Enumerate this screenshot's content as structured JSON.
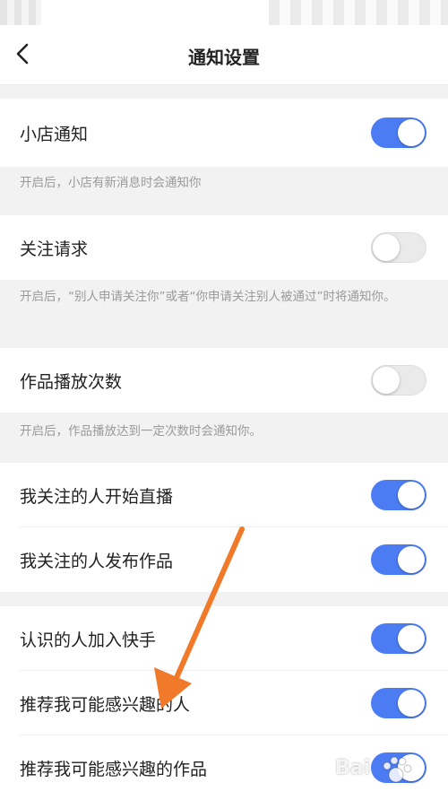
{
  "nav": {
    "title": "通知设置"
  },
  "settings": [
    {
      "label": "小店通知",
      "enabled": true,
      "description": "开启后，小店有新消息时会通知你"
    },
    {
      "label": "关注请求",
      "enabled": false,
      "description": "开启后，“别人申请关注你”或者“你申请关注别人被通过”时将通知你。"
    },
    {
      "label": "作品播放次数",
      "enabled": false,
      "description": "开启后，作品播放达到一定次数时会通知你。"
    },
    {
      "label": "我关注的人开始直播",
      "enabled": true
    },
    {
      "label": "我关注的人发布作品",
      "enabled": true
    },
    {
      "label": "认识的人加入快手",
      "enabled": true
    },
    {
      "label": "推荐我可能感兴趣的人",
      "enabled": true
    },
    {
      "label": "推荐我可能感兴趣的作品",
      "enabled": true
    }
  ],
  "colors": {
    "toggle_on": "#4c7cf3",
    "toggle_off": "#eaeaea",
    "annotation_arrow": "#f07a2a"
  },
  "watermark": {
    "text": "Bai"
  }
}
